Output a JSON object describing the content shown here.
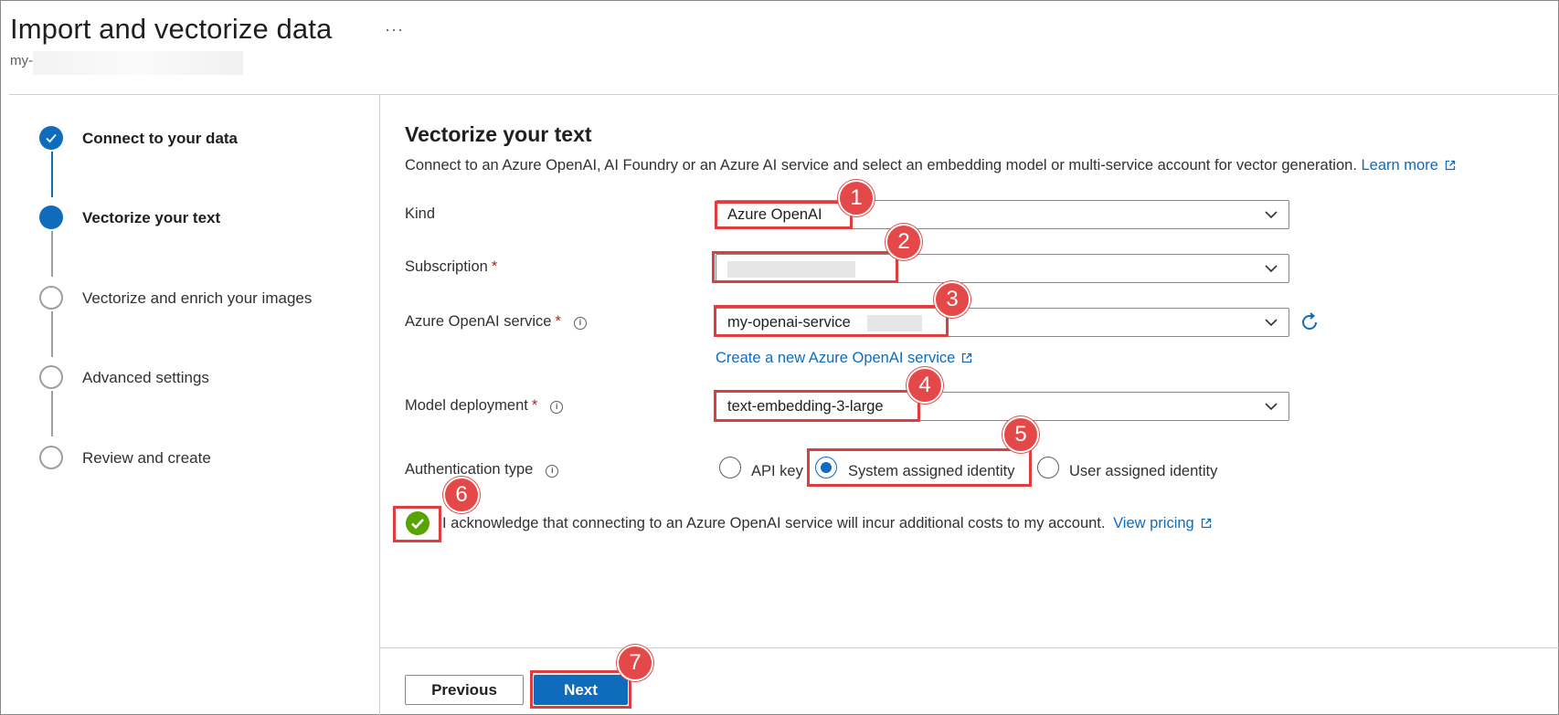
{
  "header": {
    "title": "Import and vectorize data",
    "more_label": "···",
    "subtitle_prefix": "my-"
  },
  "steps": [
    {
      "label": "Connect to your data",
      "state": "done"
    },
    {
      "label": "Vectorize your text",
      "state": "current"
    },
    {
      "label": "Vectorize and enrich your images",
      "state": "todo"
    },
    {
      "label": "Advanced settings",
      "state": "todo"
    },
    {
      "label": "Review and create",
      "state": "todo"
    }
  ],
  "main": {
    "title": "Vectorize your text",
    "description": "Connect to an Azure OpenAI, AI Foundry or an Azure AI service and select an embedding model or multi-service account for vector generation.",
    "learn_more": "Learn more",
    "kind": {
      "label": "Kind",
      "value": "Azure OpenAI"
    },
    "subscription": {
      "label": "Subscription",
      "required": "*",
      "value": ""
    },
    "openai_service": {
      "label": "Azure OpenAI service",
      "required": "*",
      "value": "my-openai-service"
    },
    "create_link": "Create a new Azure OpenAI service",
    "model_deployment": {
      "label": "Model deployment",
      "required": "*",
      "value": "text-embedding-3-large"
    },
    "auth": {
      "label": "Authentication type",
      "options": [
        "API key",
        "System assigned identity",
        "User assigned identity"
      ],
      "selected": "System assigned identity"
    },
    "acknowledge": "I acknowledge that connecting to an Azure OpenAI service will incur additional costs to my account.",
    "view_pricing": "View pricing"
  },
  "footer": {
    "previous": "Previous",
    "next": "Next"
  },
  "callouts": [
    "1",
    "2",
    "3",
    "4",
    "5",
    "6",
    "7"
  ],
  "colors": {
    "accent": "#0f6cbd",
    "callout": "#e03e3e",
    "success": "#57a300"
  }
}
